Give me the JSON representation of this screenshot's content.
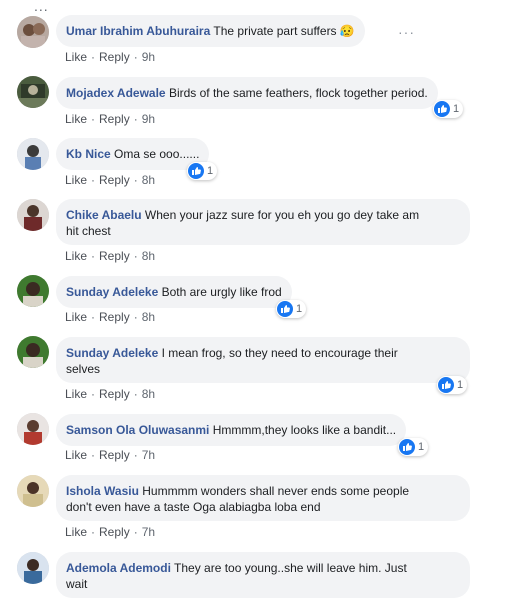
{
  "top_dots": "...",
  "action_like": "Like",
  "action_reply": "Reply",
  "action_sep": "·",
  "more_label": "···",
  "comments": [
    {
      "author": "Umar Ibrahim Abuhuraira",
      "text": "The private part suffers 😥",
      "time": "9h"
    },
    {
      "author": "Mojadex Adewale",
      "text": "Birds of the same feathers, flock together period.",
      "time": "9h",
      "reactions": "1"
    },
    {
      "author": "Kb Nice",
      "text": "Oma se ooo......",
      "time": "8h",
      "reactions": "1"
    },
    {
      "author": "Chike Abaelu",
      "text": "When your jazz sure for you eh you go dey take am",
      "text2": "hit chest",
      "time": "8h"
    },
    {
      "author": "Sunday Adeleke",
      "text": "Both are urgly like frod",
      "time": "8h",
      "reactions": "1"
    },
    {
      "author": "Sunday Adeleke",
      "text": "I mean frog, so they need to encourage their",
      "text2": "selves",
      "time": "8h",
      "reactions": "1"
    },
    {
      "author": "Samson Ola Oluwasanmi",
      "text": "Hmmmm,they looks like a bandit...",
      "time": "7h",
      "reactions": "1"
    },
    {
      "author": "Ishola Wasiu",
      "text": "Hummmm wonders shall never ends some people",
      "text2": "don't even have a taste Oga alabiagba loba end",
      "time": "7h"
    },
    {
      "author": "Ademola Ademodi",
      "text": "They are too young..she will leave him. Just",
      "text2": "wait"
    }
  ],
  "colors": {
    "author": "#385898",
    "bubble": "#f2f3f5",
    "like_blue": "#1877f2",
    "meta": "#606770"
  }
}
